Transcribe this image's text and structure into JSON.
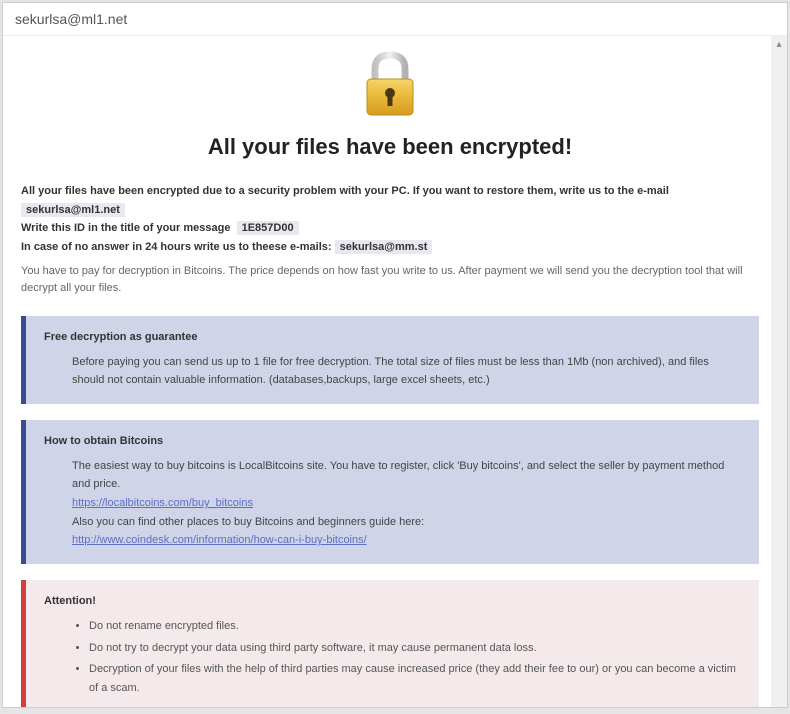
{
  "titlebar": "sekurlsa@ml1.net",
  "heading": "All your files have been encrypted!",
  "intro": {
    "line1_a": "All your files have been encrypted due to a security problem with your PC. If you want to restore them, write us to the e-mail",
    "email1": "sekurlsa@ml1.net",
    "line2_a": "Write this ID in the title of your message",
    "id_code": "1E857D00",
    "line3_a": "In case of no answer in 24 hours write us to theese e-mails:",
    "email2": "sekurlsa@mm.st"
  },
  "pay_note": "You have to pay for decryption in Bitcoins. The price depends on how fast you write to us. After payment we will send you the decryption tool that will decrypt all your files.",
  "box_free": {
    "title": "Free decryption as guarantee",
    "body": "Before paying you can send us up to 1 file for free decryption. The total size of files must be less than 1Mb (non archived), and files should not contain valuable information. (databases,backups, large excel sheets, etc.)"
  },
  "box_btc": {
    "title": "How to obtain Bitcoins",
    "line1": "The easiest way to buy bitcoins is LocalBitcoins site. You have to register, click 'Buy bitcoins', and select the seller by payment method and price.",
    "link1": "https://localbitcoins.com/buy_bitcoins",
    "line2": "Also you can find other places to buy Bitcoins and beginners guide here:",
    "link2": "http://www.coindesk.com/information/how-can-i-buy-bitcoins/"
  },
  "box_attn": {
    "title": "Attention!",
    "item1": "Do not rename encrypted files.",
    "item2": "Do not try to decrypt your data using third party software, it may cause permanent data loss.",
    "item3": "Decryption of your files with the help of third parties may cause increased price (they add their fee to our) or you can become a victim of a scam."
  }
}
